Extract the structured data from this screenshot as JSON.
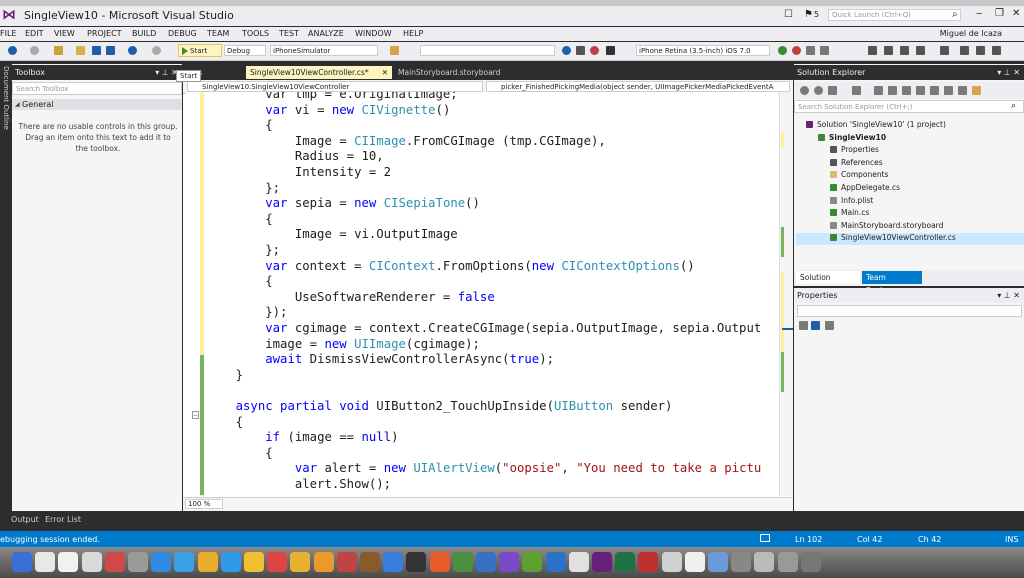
{
  "window": {
    "title": "SingleView10 - Microsoft Visual Studio",
    "quick_launch_placeholder": "Quick Launch (Ctrl+Q)",
    "notification_count": "5",
    "user": "Miguel de Icaza"
  },
  "menu": [
    "FILE",
    "EDIT",
    "VIEW",
    "PROJECT",
    "BUILD",
    "DEBUG",
    "TEAM",
    "TOOLS",
    "TEST",
    "ANALYZE",
    "WINDOW",
    "HELP"
  ],
  "toolbar": {
    "start_label": "Start",
    "config": "Debug",
    "platform": "iPhoneSimulator",
    "device": "iPhone Retina (3.5-inch) iOS 7.0",
    "tooltip": "Start"
  },
  "left_strip": {
    "label": "Document Outline"
  },
  "toolbox": {
    "title": "Toolbox",
    "search_placeholder": "Search Toolbox",
    "group": "General",
    "message": "There are no usable controls in this group. Drag an item onto this text to add it to the toolbox."
  },
  "editor": {
    "tabs": [
      {
        "label": "n.cs"
      },
      {
        "label": "SingleView10ViewController.cs*"
      },
      {
        "label": "MainStoryboard.storyboard"
      }
    ],
    "nav_class": "SingleView10.SingleView10ViewController",
    "nav_member": "picker_FinishedPickingMedia(object sender, UIImagePickerMediaPickedEventA",
    "zoom": "100 %"
  },
  "code_lines": [
    [
      {
        "t": "        var tmp = e.OriginalImage;",
        "c": ""
      }
    ],
    [
      {
        "t": "        ",
        "c": ""
      },
      {
        "t": "var",
        "c": "kw"
      },
      {
        "t": " vi = ",
        "c": ""
      },
      {
        "t": "new",
        "c": "kw"
      },
      {
        "t": " ",
        "c": ""
      },
      {
        "t": "CIVignette",
        "c": "ty"
      },
      {
        "t": "()",
        "c": ""
      }
    ],
    [
      {
        "t": "        {",
        "c": ""
      }
    ],
    [
      {
        "t": "            Image = ",
        "c": ""
      },
      {
        "t": "CIImage",
        "c": "ty"
      },
      {
        "t": ".FromCGImage (tmp.CGImage),",
        "c": ""
      }
    ],
    [
      {
        "t": "            Radius = 10,",
        "c": ""
      }
    ],
    [
      {
        "t": "            Intensity = 2",
        "c": ""
      }
    ],
    [
      {
        "t": "        };",
        "c": ""
      }
    ],
    [
      {
        "t": "        ",
        "c": ""
      },
      {
        "t": "var",
        "c": "kw"
      },
      {
        "t": " sepia = ",
        "c": ""
      },
      {
        "t": "new",
        "c": "kw"
      },
      {
        "t": " ",
        "c": ""
      },
      {
        "t": "CISepiaTone",
        "c": "ty"
      },
      {
        "t": "()",
        "c": ""
      }
    ],
    [
      {
        "t": "        {",
        "c": ""
      }
    ],
    [
      {
        "t": "            Image = vi.OutputImage",
        "c": ""
      }
    ],
    [
      {
        "t": "        };",
        "c": ""
      }
    ],
    [
      {
        "t": "        ",
        "c": ""
      },
      {
        "t": "var",
        "c": "kw"
      },
      {
        "t": " context = ",
        "c": ""
      },
      {
        "t": "CIContext",
        "c": "ty"
      },
      {
        "t": ".FromOptions(",
        "c": ""
      },
      {
        "t": "new",
        "c": "kw"
      },
      {
        "t": " ",
        "c": ""
      },
      {
        "t": "CIContextOptions",
        "c": "ty"
      },
      {
        "t": "()",
        "c": ""
      }
    ],
    [
      {
        "t": "        {",
        "c": ""
      }
    ],
    [
      {
        "t": "            UseSoftwareRenderer = ",
        "c": ""
      },
      {
        "t": "false",
        "c": "kw"
      }
    ],
    [
      {
        "t": "        });",
        "c": ""
      }
    ],
    [
      {
        "t": "        ",
        "c": ""
      },
      {
        "t": "var",
        "c": "kw"
      },
      {
        "t": " cgimage = context.CreateCGImage(sepia.OutputImage, sepia.Output",
        "c": ""
      }
    ],
    [
      {
        "t": "        image = ",
        "c": ""
      },
      {
        "t": "new",
        "c": "kw"
      },
      {
        "t": " ",
        "c": ""
      },
      {
        "t": "UIImage",
        "c": "ty"
      },
      {
        "t": "(cgimage);",
        "c": ""
      }
    ],
    [
      {
        "t": "        ",
        "c": ""
      },
      {
        "t": "await",
        "c": "kw"
      },
      {
        "t": " DismissViewControllerAsync(",
        "c": ""
      },
      {
        "t": "true",
        "c": "kw"
      },
      {
        "t": ");",
        "c": ""
      }
    ],
    [
      {
        "t": "    }",
        "c": ""
      }
    ],
    [
      {
        "t": "",
        "c": ""
      }
    ],
    [
      {
        "t": "    ",
        "c": ""
      },
      {
        "t": "async partial void",
        "c": "kw"
      },
      {
        "t": " UIButton2_TouchUpInside(",
        "c": ""
      },
      {
        "t": "UIButton",
        "c": "ty"
      },
      {
        "t": " sender)",
        "c": ""
      }
    ],
    [
      {
        "t": "    {",
        "c": ""
      }
    ],
    [
      {
        "t": "        ",
        "c": ""
      },
      {
        "t": "if",
        "c": "kw"
      },
      {
        "t": " (image == ",
        "c": ""
      },
      {
        "t": "null",
        "c": "kw"
      },
      {
        "t": ")",
        "c": ""
      }
    ],
    [
      {
        "t": "        {",
        "c": ""
      }
    ],
    [
      {
        "t": "            ",
        "c": ""
      },
      {
        "t": "var",
        "c": "kw"
      },
      {
        "t": " alert = ",
        "c": ""
      },
      {
        "t": "new",
        "c": "kw"
      },
      {
        "t": " ",
        "c": ""
      },
      {
        "t": "UIAlertView",
        "c": "ty"
      },
      {
        "t": "(",
        "c": ""
      },
      {
        "t": "\"oopsie\"",
        "c": "str"
      },
      {
        "t": ", ",
        "c": ""
      },
      {
        "t": "\"You need to take a pictu",
        "c": "str"
      }
    ],
    [
      {
        "t": "            alert.Show();",
        "c": ""
      }
    ]
  ],
  "solution_explorer": {
    "title": "Solution Explorer",
    "search_placeholder": "Search Solution Explorer (Ctrl+;)",
    "items": [
      {
        "label": "Solution 'SingleView10' (1 project)",
        "indent": 0,
        "icon": "solution-icon"
      },
      {
        "label": "SingleView10",
        "indent": 1,
        "icon": "project-icon",
        "bold": true
      },
      {
        "label": "Properties",
        "indent": 2,
        "icon": "wrench-icon"
      },
      {
        "label": "References",
        "indent": 2,
        "icon": "references-icon"
      },
      {
        "label": "Components",
        "indent": 2,
        "icon": "folder-icon"
      },
      {
        "label": "AppDelegate.cs",
        "indent": 2,
        "icon": "csharp-file-icon"
      },
      {
        "label": "Info.plist",
        "indent": 2,
        "icon": "file-icon"
      },
      {
        "label": "Main.cs",
        "indent": 2,
        "icon": "csharp-file-icon"
      },
      {
        "label": "MainStoryboard.storyboard",
        "indent": 2,
        "icon": "file-icon"
      },
      {
        "label": "SingleView10ViewController.cs",
        "indent": 2,
        "icon": "csharp-file-icon",
        "selected": true
      }
    ],
    "tabs": [
      "Solution Explorer",
      "Team Explorer"
    ]
  },
  "properties": {
    "title": "Properties"
  },
  "bottom_tabs": [
    "Output",
    "Error List"
  ],
  "status": {
    "message": "ebugging session ended.",
    "ln": "Ln 102",
    "col": "Col 42",
    "ch": "Ch 42",
    "mode": "INS"
  },
  "colors": {
    "status_bar": "#007acc",
    "dark_chrome": "#2d2d30",
    "keyword": "#0000ff",
    "type": "#2b91af",
    "string": "#a31515",
    "active_tab": "#fdf4bf"
  }
}
